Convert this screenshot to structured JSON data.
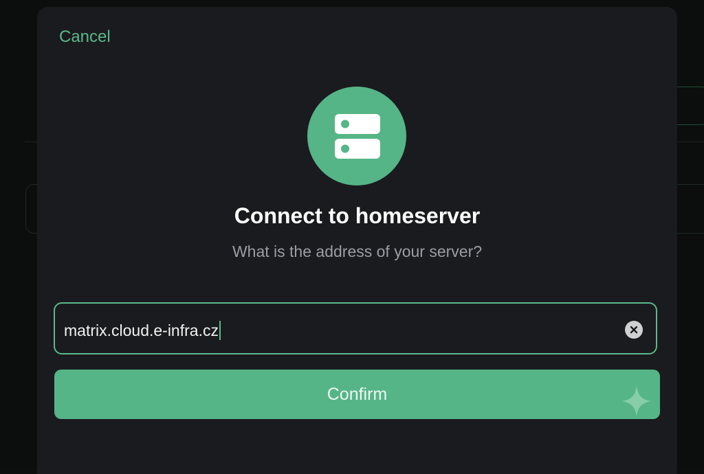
{
  "dialog": {
    "cancel_label": "Cancel",
    "icon": "server-icon",
    "title": "Connect to homeserver",
    "subtitle": "What is the address of your server?"
  },
  "server_field": {
    "value": "matrix.cloud.e-infra.cz",
    "clear_icon": "clear-icon"
  },
  "confirm_label": "Confirm",
  "decoration": {
    "sparkle_icon": "sparkle-icon"
  },
  "colors": {
    "accent": "#55b587",
    "sheet_background": "#1a1b1f",
    "page_background": "#0b0e0d"
  }
}
